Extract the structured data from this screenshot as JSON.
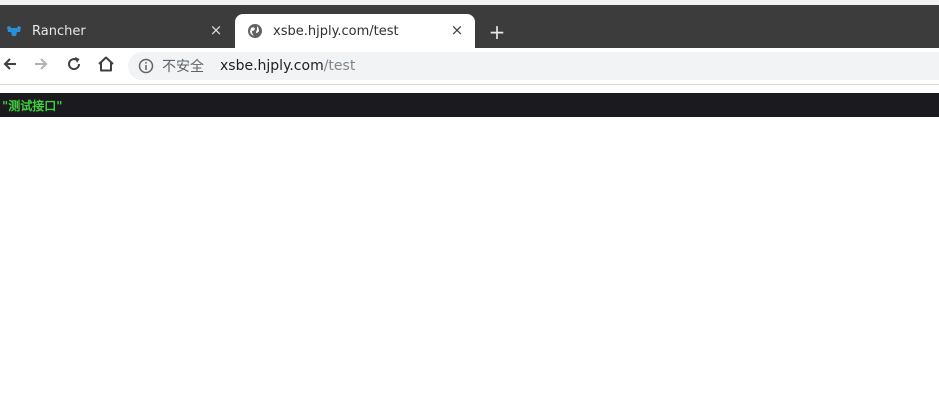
{
  "browser": {
    "tabs": [
      {
        "title": "Rancher",
        "active": false,
        "favicon": "rancher-logo-icon"
      },
      {
        "title": "xsbe.hjply.com/test",
        "active": true,
        "favicon": "globe-icon"
      }
    ],
    "close_glyph": "×",
    "new_tab_glyph": "+",
    "nav": {
      "back_icon": "arrow-left-icon",
      "forward_icon": "arrow-right-icon",
      "reload_icon": "reload-icon",
      "home_icon": "home-icon"
    },
    "address_bar": {
      "security_label": "不安全",
      "url_host": "xsbe.hjply.com",
      "url_path": "/test"
    }
  },
  "page": {
    "response_text": "\"测试接口\""
  },
  "colors": {
    "tabbar": "#3c3c3c",
    "response_bg": "#1b1a1e",
    "response_text": "#3ecf3e"
  }
}
